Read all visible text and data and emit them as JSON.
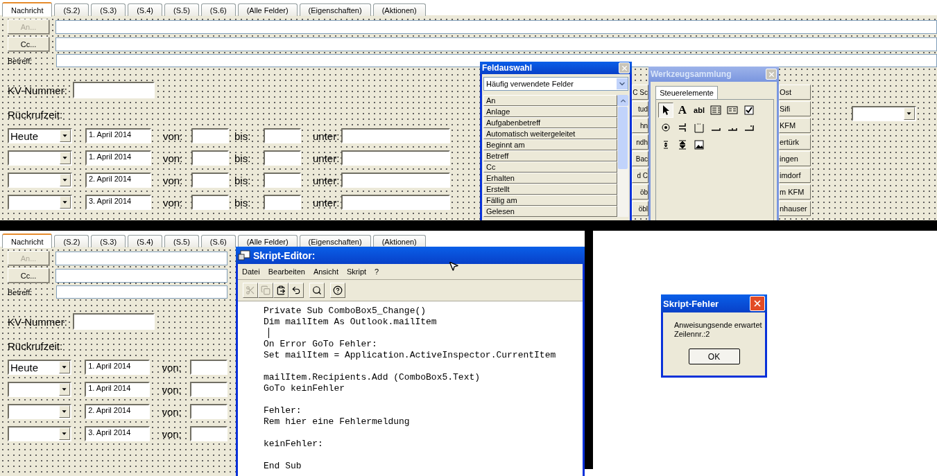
{
  "top_form": {
    "tabs": [
      {
        "label": "Nachricht",
        "selected": true
      },
      {
        "label": "(S.2)",
        "selected": false
      },
      {
        "label": "(S.3)",
        "selected": false
      },
      {
        "label": "(S.4)",
        "selected": false
      },
      {
        "label": "(S.5)",
        "selected": false
      },
      {
        "label": "(S.6)",
        "selected": false
      },
      {
        "label": "(Alle Felder)",
        "selected": false
      },
      {
        "label": "(Eigenschaften)",
        "selected": false
      },
      {
        "label": "(Aktionen)",
        "selected": false
      }
    ],
    "to_button": {
      "label": "An...",
      "disabled": true
    },
    "cc_button": {
      "label": "Cc...",
      "disabled": false
    },
    "subject_label": "Betreff:",
    "kv_label": "KV-Nummer:",
    "callback_label": "Rückrufzeit:",
    "rows": [
      {
        "day": "Heute",
        "date": "1. April 2014",
        "from_label": "von:",
        "to_label": "bis:",
        "under_label": "unter:"
      },
      {
        "date": "1. April 2014",
        "from_label": "von:",
        "to_label": "bis:",
        "under_label": "unter:"
      },
      {
        "date": "2. April 2014",
        "from_label": "von:",
        "to_label": "bis:",
        "under_label": "unter:"
      },
      {
        "date": "3. April 2014",
        "from_label": "von:",
        "to_label": "bis:",
        "under_label": "unter:"
      }
    ]
  },
  "hidden_buttons": [
    {
      "left": "C Sc",
      "right": "Ost"
    },
    {
      "left": "tud",
      "right": "Sifi"
    },
    {
      "left": "hn",
      "right": "KFM"
    },
    {
      "left": "ndh",
      "right": "ertürk"
    },
    {
      "left": "Bac",
      "right": "ingen"
    },
    {
      "left": "d C",
      "right": "imdorf"
    },
    {
      "left": "öb",
      "right": "m KFM"
    },
    {
      "left": "öbl",
      "right": "nhauser"
    }
  ],
  "field_chooser": {
    "title": "Feldauswahl",
    "dropdown": "Häufig verwendete Felder",
    "items": [
      "An",
      "Anlage",
      "Aufgabenbetreff",
      "Automatisch weitergeleitet",
      "Beginnt am",
      "Betreff",
      "Cc",
      "Erhalten",
      "Erstellt",
      "Fällig am",
      "Gelesen"
    ]
  },
  "toolbox": {
    "title": "Werkzeugsammlung",
    "active": false,
    "tab": "Steuerelemente",
    "tools": [
      {
        "kind": "pointer",
        "selected": true
      },
      {
        "kind": "label",
        "glyph": "A",
        "selected": false
      },
      {
        "kind": "textbox",
        "glyph": "abl",
        "selected": false
      },
      {
        "kind": "combobox",
        "selected": false
      },
      {
        "kind": "listbox",
        "selected": false
      },
      {
        "kind": "checkbox",
        "selected": false
      },
      {
        "kind": "radio",
        "selected": false
      },
      {
        "kind": "toggle",
        "selected": false
      },
      {
        "kind": "frame",
        "selected": false
      },
      {
        "kind": "commandbutton",
        "selected": false
      },
      {
        "kind": "tabstrip",
        "selected": false
      },
      {
        "kind": "multipage",
        "selected": false
      },
      {
        "kind": "spin",
        "selected": false
      },
      {
        "kind": "scroll",
        "selected": false
      },
      {
        "kind": "image",
        "selected": false
      }
    ]
  },
  "bottom_form": {
    "tabs": [
      {
        "label": "Nachricht",
        "selected": true
      },
      {
        "label": "(S.2)",
        "selected": false
      },
      {
        "label": "(S.3)",
        "selected": false
      },
      {
        "label": "(S.4)",
        "selected": false
      },
      {
        "label": "(S.5)",
        "selected": false
      },
      {
        "label": "(S.6)",
        "selected": false
      },
      {
        "label": "(Alle Felder)",
        "selected": false
      },
      {
        "label": "(Eigenschaften)",
        "selected": false
      },
      {
        "label": "(Aktionen)",
        "selected": false
      }
    ],
    "to_button": {
      "label": "An...",
      "disabled": true
    },
    "cc_button": {
      "label": "Cc...",
      "disabled": false
    },
    "subject_label": "Betreff:",
    "kv_label": "KV-Nummer:",
    "callback_label": "Rückrufzeit:",
    "rows": [
      {
        "day": "Heute",
        "date": "1. April 2014",
        "from_label": "von:"
      },
      {
        "date": "1. April 2014",
        "from_label": "von:"
      },
      {
        "date": "2. April 2014",
        "from_label": "von:"
      },
      {
        "date": "3. April 2014",
        "from_label": "von:"
      }
    ]
  },
  "script_editor": {
    "title": "Skript-Editor:",
    "menu": [
      "Datei",
      "Bearbeiten",
      "Ansicht",
      "Skript",
      "?"
    ],
    "toolbar": [
      {
        "kind": "cut",
        "disabled": true
      },
      {
        "kind": "copy",
        "disabled": true
      },
      {
        "kind": "paste",
        "disabled": false
      },
      {
        "kind": "undo",
        "disabled": false
      },
      {
        "kind": "find",
        "disabled": false
      },
      {
        "kind": "help",
        "disabled": false
      }
    ],
    "lines": [
      {
        "kind": "code",
        "text": "Private Sub ComboBox5_Change()"
      },
      {
        "kind": "code",
        "text": "Dim mailItem As Outlook.mailItem"
      },
      {
        "kind": "caret"
      },
      {
        "kind": "code",
        "text": "On Error GoTo Fehler:"
      },
      {
        "kind": "code",
        "text": "Set mailItem = Application.ActiveInspector.CurrentItem"
      },
      {
        "kind": "blank"
      },
      {
        "kind": "code",
        "text": "mailItem.Recipients.Add (ComboBox5.Text)"
      },
      {
        "kind": "code",
        "text": "GoTo keinFehler"
      },
      {
        "kind": "blank"
      },
      {
        "kind": "code",
        "text": "Fehler:"
      },
      {
        "kind": "code",
        "text": "Rem hier eine Fehlermeldung"
      },
      {
        "kind": "blank"
      },
      {
        "kind": "code",
        "text": "keinFehler:"
      },
      {
        "kind": "blank"
      },
      {
        "kind": "code",
        "text": "End Sub"
      }
    ]
  },
  "error_dialog": {
    "title": "Skript-Fehler",
    "message": "Anweisungsende erwartet",
    "line_info": "Zeilennr.:2",
    "button": "OK"
  }
}
